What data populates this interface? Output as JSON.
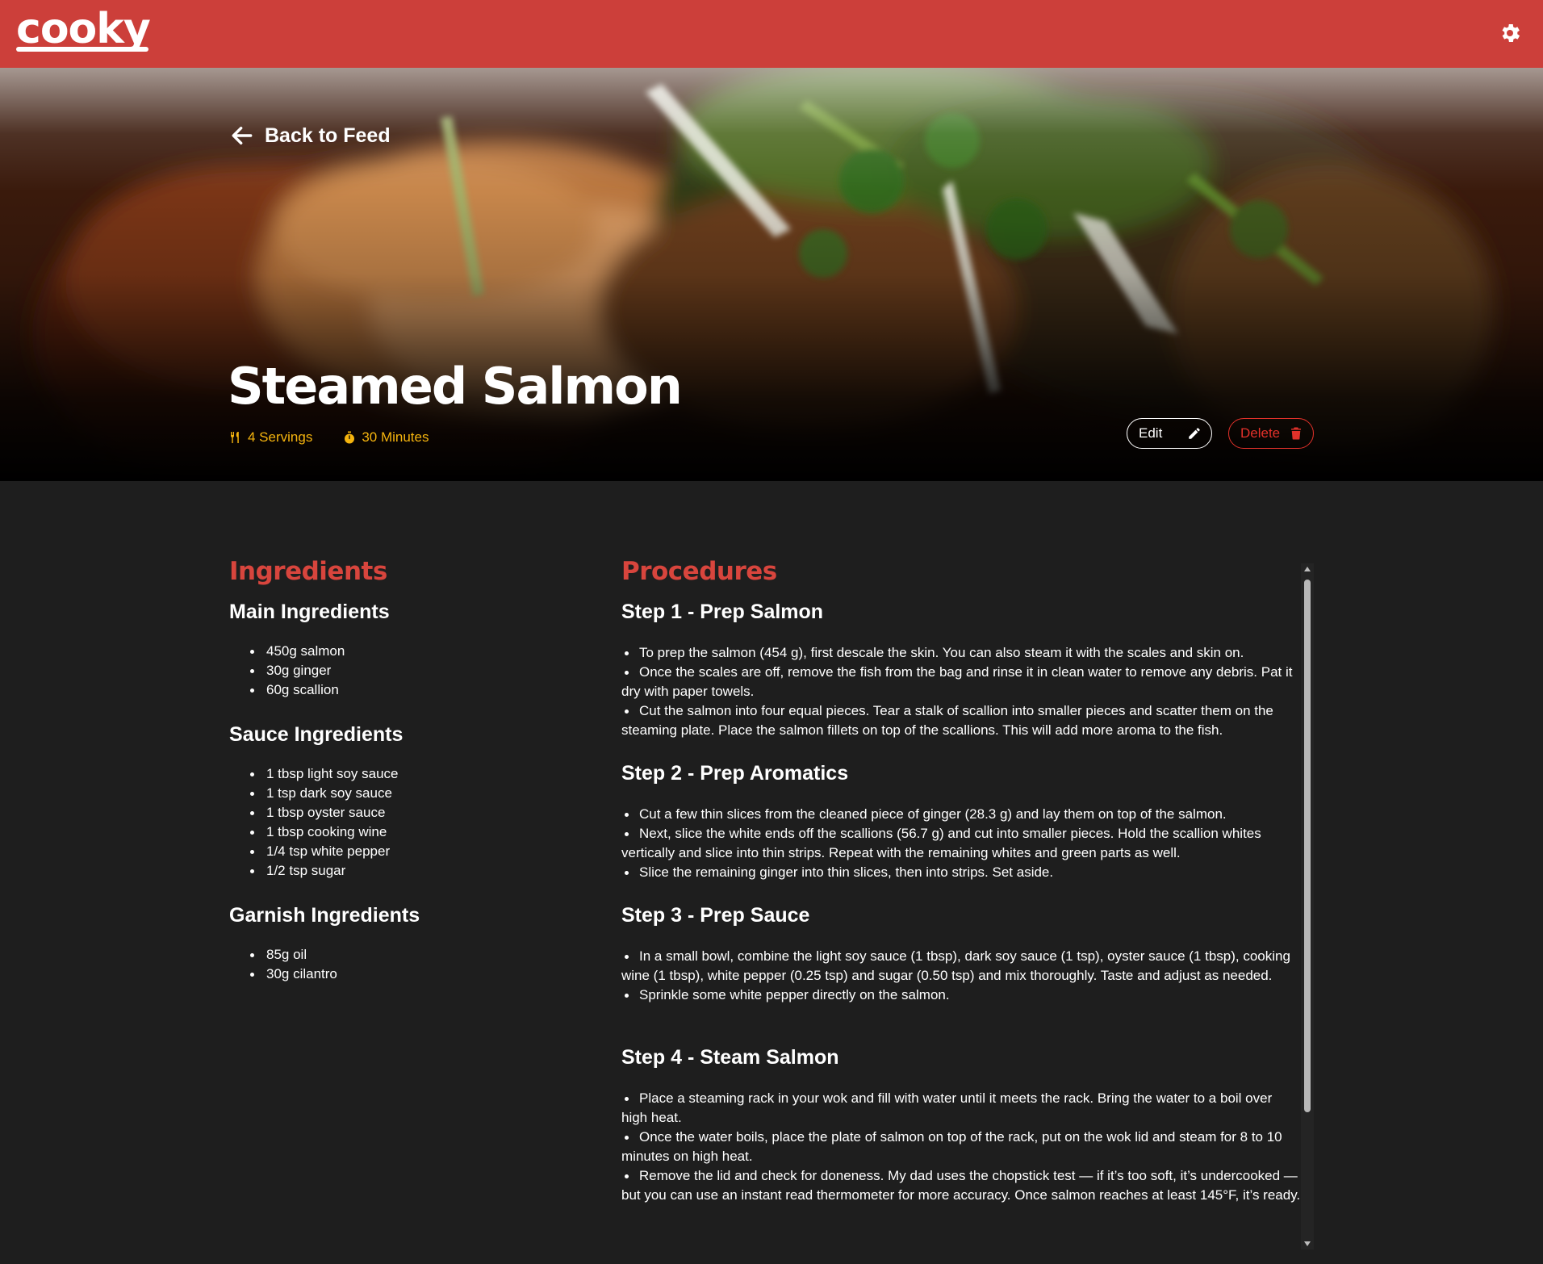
{
  "app": {
    "logo_text": "cooky"
  },
  "hero": {
    "back_label": "Back to Feed",
    "title": "Steamed Salmon",
    "servings": "4 Servings",
    "time": "30 Minutes",
    "edit_label": "Edit",
    "delete_label": "Delete"
  },
  "ingredients": {
    "heading": "Ingredients",
    "groups": [
      {
        "title": "Main Ingredients",
        "items": [
          "450g salmon",
          "30g ginger",
          "60g scallion"
        ]
      },
      {
        "title": "Sauce Ingredients",
        "items": [
          "1 tbsp light soy sauce",
          "1 tsp dark soy sauce",
          "1 tbsp oyster sauce",
          "1 tbsp cooking wine",
          "1/4 tsp white pepper",
          "1/2 tsp sugar"
        ]
      },
      {
        "title": "Garnish Ingredients",
        "items": [
          "85g oil",
          "30g cilantro"
        ]
      }
    ]
  },
  "procedures": {
    "heading": "Procedures",
    "steps": [
      {
        "title": "Step 1 - Prep Salmon",
        "items": [
          "To prep the salmon (454 g), first descale the skin. You can also steam it with the scales and skin on.",
          "Once the scales are off, remove the fish from the bag and rinse it in clean water to remove any debris. Pat it dry with paper towels.",
          "Cut the salmon into four equal pieces. Tear a stalk of scallion into smaller pieces and scatter them on the steaming plate. Place the salmon fillets on top of the scallions. This will add more aroma to the fish."
        ]
      },
      {
        "title": "Step 2 - Prep Aromatics",
        "items": [
          "Cut a few thin slices from the cleaned piece of ginger (28.3 g) and lay them on top of the salmon.",
          "Next, slice the white ends off the scallions (56.7 g) and cut into smaller pieces. Hold the scallion whites vertically and slice into thin strips. Repeat with the remaining whites and green parts as well.",
          "Slice the remaining ginger into thin slices, then into strips. Set aside."
        ]
      },
      {
        "title": "Step 3 - Prep Sauce",
        "items": [
          "In a small bowl, combine the light soy sauce (1 tbsp), dark soy sauce (1 tsp), oyster sauce (1 tbsp), cooking wine (1 tbsp), white pepper (0.25 tsp) and sugar (0.50 tsp) and mix thoroughly. Taste and adjust as needed.",
          "Sprinkle some white pepper directly on the salmon."
        ]
      },
      {
        "title": "Step 4 - Steam Salmon",
        "items": [
          "Place a steaming rack in your wok and fill with water until it meets the rack. Bring the water to a boil over high heat.",
          "Once the water boils, place the plate of salmon on top of the rack, put on the wok lid and steam for 8 to 10 minutes on high heat.",
          "Remove the lid and check for doneness. My dad uses the chopstick test — if it’s too soft, it’s undercooked — but you can use an instant read thermometer for more accuracy. Once salmon reaches at least 145°F, it’s ready."
        ]
      }
    ]
  },
  "icons": {
    "settings": "gear-icon",
    "back": "arrow-left-icon",
    "servings": "utensils-icon",
    "time": "stopwatch-icon",
    "edit": "pencil-icon",
    "delete": "trash-icon"
  },
  "colors": {
    "brand": "#cc3f3a",
    "accent_heading": "#d8453d",
    "meta": "#f5b40e",
    "danger": "#e2312a",
    "background": "#1e1e1e"
  }
}
